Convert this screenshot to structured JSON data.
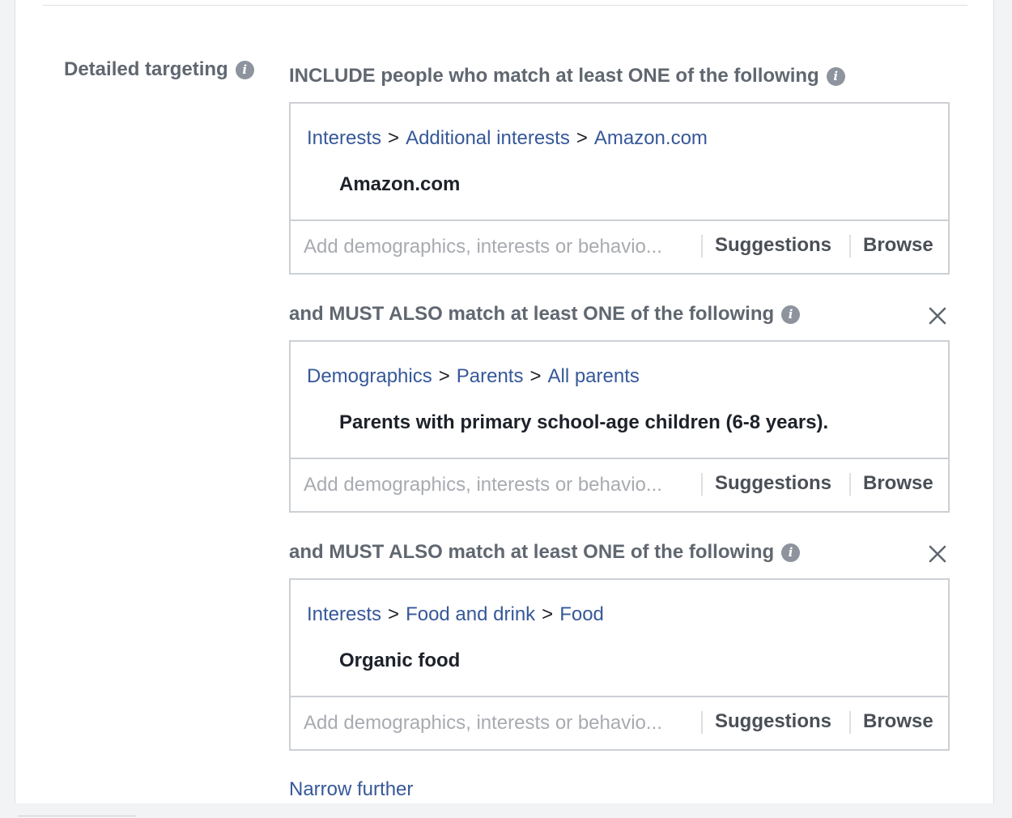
{
  "section": {
    "label": "Detailed targeting"
  },
  "groups": [
    {
      "header": "INCLUDE people who match at least ONE of the following",
      "removable": false,
      "breadcrumb": [
        "Interests",
        "Additional interests",
        "Amazon.com"
      ],
      "separator": ">",
      "item": "Amazon.com",
      "placeholder": "Add demographics, interests or behavio...",
      "suggestions_label": "Suggestions",
      "browse_label": "Browse"
    },
    {
      "header": "and MUST ALSO match at least ONE of the following",
      "removable": true,
      "breadcrumb": [
        "Demographics",
        "Parents",
        "All parents"
      ],
      "separator": ">",
      "item": "Parents with primary school-age children (6-8 years).",
      "placeholder": "Add demographics, interests or behavio...",
      "suggestions_label": "Suggestions",
      "browse_label": "Browse"
    },
    {
      "header": "and MUST ALSO match at least ONE of the following",
      "removable": true,
      "breadcrumb": [
        "Interests",
        "Food and drink",
        "Food"
      ],
      "separator": ">",
      "item": "Organic food",
      "placeholder": "Add demographics, interests or behavio...",
      "suggestions_label": "Suggestions",
      "browse_label": "Browse"
    }
  ],
  "narrow_further": "Narrow further",
  "icons": {
    "info": "info-icon",
    "close": "close-icon"
  },
  "colors": {
    "link": "#365899",
    "label": "#606770",
    "text": "#1d2129",
    "border": "#ccd0d5"
  }
}
